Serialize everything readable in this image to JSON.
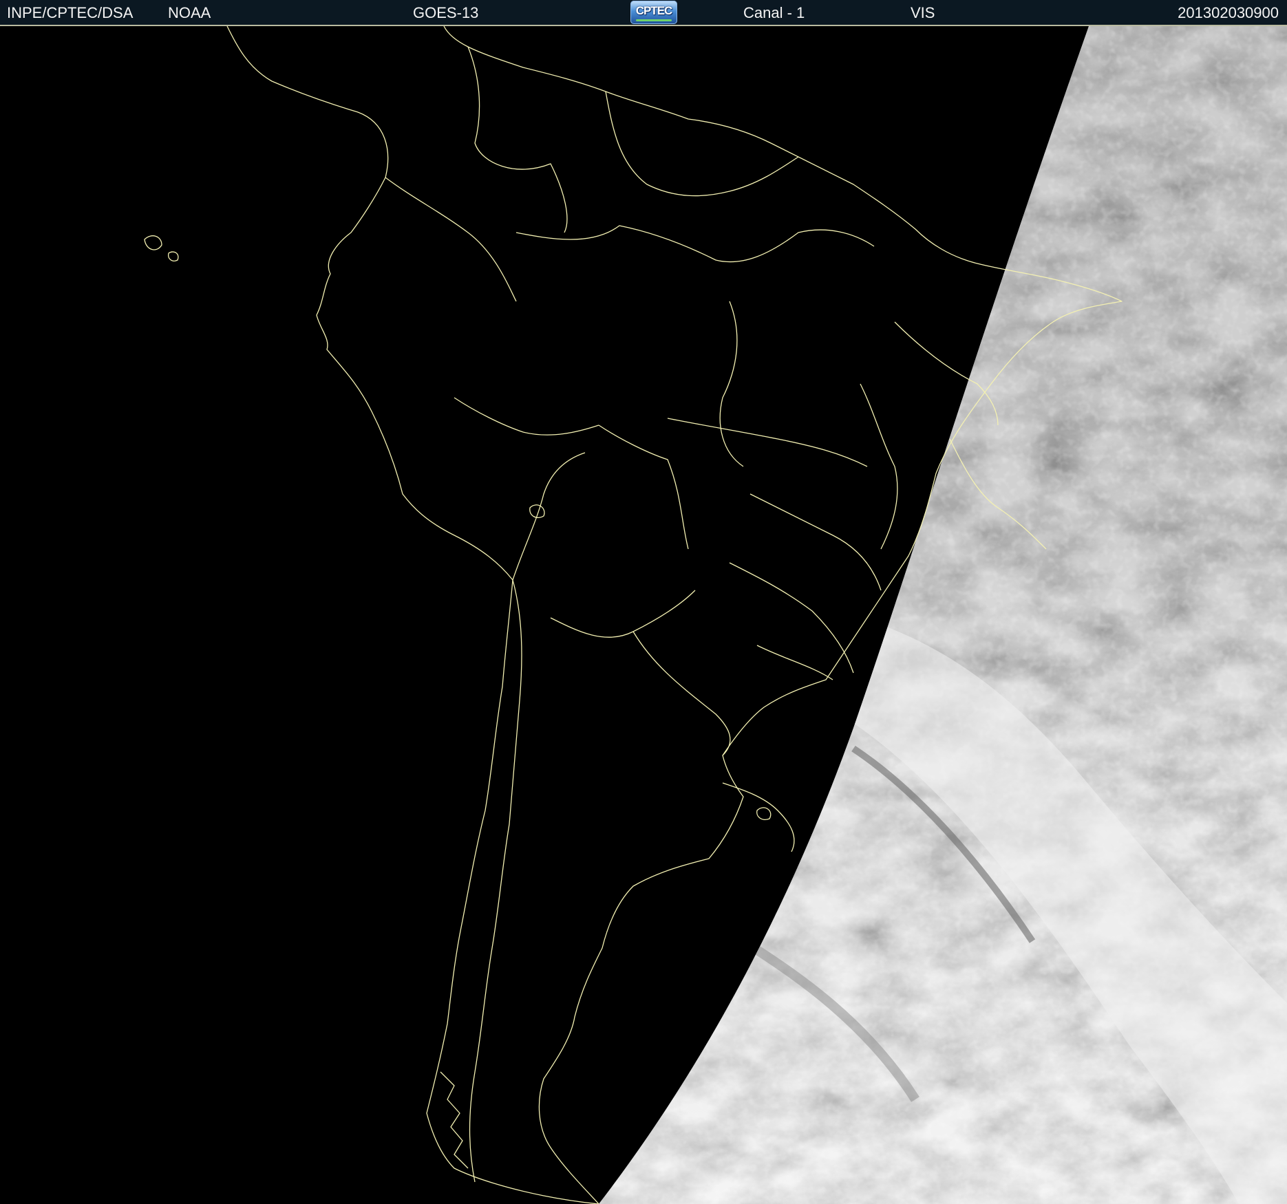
{
  "header": {
    "organization": "INPE/CPTEC/DSA",
    "agency": "NOAA",
    "satellite": "GOES-13",
    "channel": "Canal - 1",
    "band": "VIS",
    "timestamp": "201302030900"
  },
  "logo": {
    "text": "CPTEC"
  },
  "map": {
    "image_type": "satellite-visible",
    "night_color": "#000000",
    "border_color": "#f3f0b2",
    "cloud_colors": [
      "#8f8f8f",
      "#bdbdbd",
      "#e6e6e6"
    ]
  }
}
